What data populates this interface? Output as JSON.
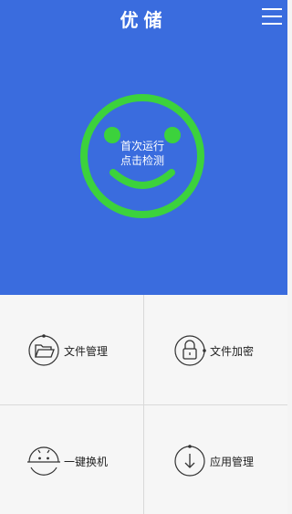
{
  "header": {
    "title": "优储",
    "menu_icon": "hamburger-menu-icon",
    "background_color": "#3a6cde"
  },
  "scan": {
    "line1": "首次运行",
    "line2": "点击检测",
    "face_icon": "smiley-face-icon",
    "face_color": "#3cd23c"
  },
  "tools": [
    {
      "label": "文件管理",
      "icon": "folder-icon"
    },
    {
      "label": "文件加密",
      "icon": "lock-icon"
    },
    {
      "label": "一键换机",
      "icon": "android-icon"
    },
    {
      "label": "应用管理",
      "icon": "download-arrow-icon"
    }
  ]
}
